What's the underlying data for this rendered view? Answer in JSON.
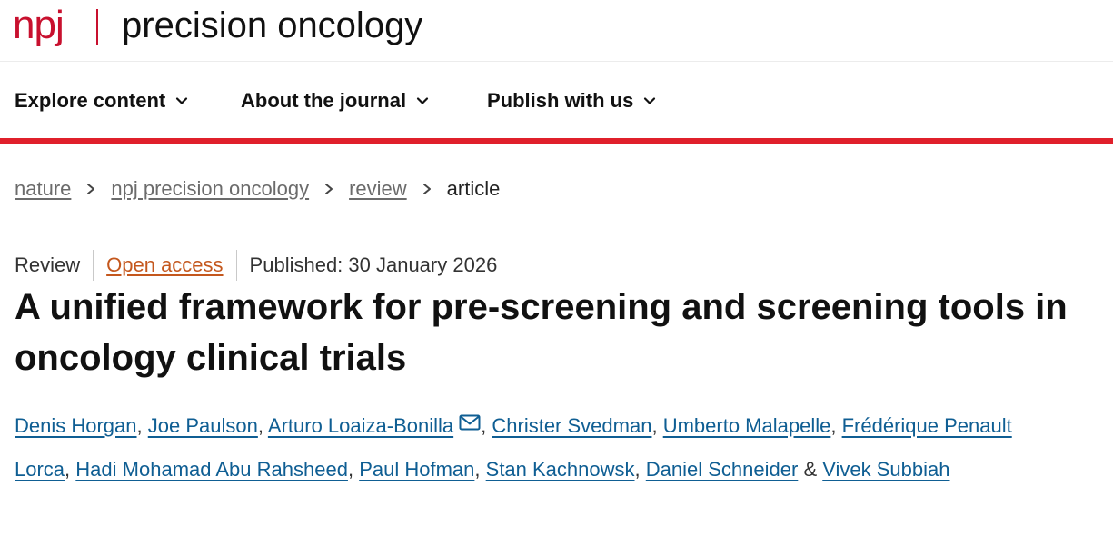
{
  "brand": {
    "publisher_mark": "npj",
    "journal_name": "precision oncology",
    "accent_color": "#c8102e"
  },
  "nav": {
    "items": [
      {
        "label": "Explore content",
        "icon": "chevron-down-icon"
      },
      {
        "label": "About the journal",
        "icon": "chevron-down-icon"
      },
      {
        "label": "Publish with us",
        "icon": "chevron-down-icon"
      }
    ],
    "underline_color": "#e0202b"
  },
  "breadcrumb": {
    "items": [
      "nature",
      "npj precision oncology",
      "review"
    ],
    "current": "article",
    "separator_icon": "chevron-right-icon"
  },
  "article": {
    "type": "Review",
    "access": "Open access",
    "published": "Published: 30 January 2026",
    "title": "A unified framework for pre-screening and screening tools in oncology clinical trials",
    "authors": [
      "Denis Horgan",
      "Joe Paulson",
      "Arturo Loaiza-Bonilla",
      "Christer Svedman",
      "Umberto Malapelle",
      "Frédérique Penault Lorca",
      "Hadi Mohamad Abu Rahsheed",
      "Paul Hofman",
      "Stan Kachnowsk",
      "Daniel Schneider",
      "Vivek Subbiah"
    ],
    "corresponding_author_icon": "mail-icon",
    "author_separator": ",",
    "last_author_joiner": "&",
    "link_color": "#0f5e93",
    "open_access_color": "#c4571d"
  }
}
